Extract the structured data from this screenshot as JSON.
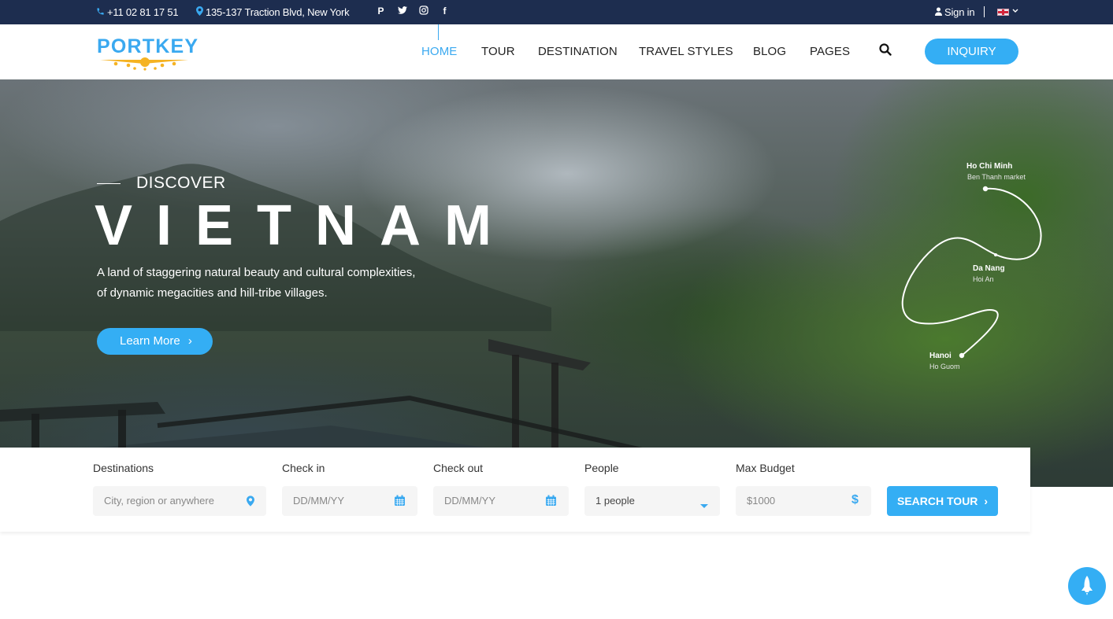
{
  "topbar": {
    "phone": "+11 02 81 17 51",
    "address": "135-137 Traction Blvd, New York",
    "social": [
      {
        "name": "pinterest",
        "glyph": "P"
      },
      {
        "name": "twitter",
        "glyph": "t"
      },
      {
        "name": "instagram",
        "glyph": "◎"
      },
      {
        "name": "facebook",
        "glyph": "f"
      }
    ],
    "sign_in": "Sign in",
    "language": "en-GB"
  },
  "header": {
    "logo": "PORTKEY",
    "nav": [
      {
        "label": "HOME",
        "active": true
      },
      {
        "label": "TOUR",
        "active": false
      },
      {
        "label": "DESTINATION",
        "active": false
      },
      {
        "label": "TRAVEL STYLES",
        "active": false
      },
      {
        "label": "BLOG",
        "active": false
      },
      {
        "label": "PAGES",
        "active": false
      }
    ],
    "inquiry_label": "INQUIRY"
  },
  "hero": {
    "kicker": "DISCOVER",
    "title": "VIETNAM",
    "description": "A land of staggering natural beauty and cultural complexities, of dynamic megacities and hill-tribe villages.",
    "cta_label": "Learn More",
    "cta_chevron": "›",
    "route": [
      {
        "city": "Ho Chi Minh",
        "place": "Ben Thanh market"
      },
      {
        "city": "Da Nang",
        "place": "Hoi An"
      },
      {
        "city": "Hanoi",
        "place": "Ho Guom"
      }
    ]
  },
  "search": {
    "fields": [
      {
        "label": "Destinations",
        "placeholder": "City, region or anywhere",
        "icon": "map-pin-icon"
      },
      {
        "label": "Check in",
        "placeholder": "DD/MM/YY",
        "icon": "calendar-icon"
      },
      {
        "label": "Check out",
        "placeholder": "DD/MM/YY",
        "icon": "calendar-icon"
      },
      {
        "label": "People",
        "value": "1 people",
        "icon": "caret-down-icon"
      },
      {
        "label": "Max Budget",
        "placeholder": "$1000",
        "icon": "dollar-icon"
      }
    ],
    "button_label": "SEARCH TOUR",
    "button_chevron": "›"
  },
  "colors": {
    "accent": "#34aef4",
    "topbar": "#1d2d4f",
    "text": "#222222"
  }
}
